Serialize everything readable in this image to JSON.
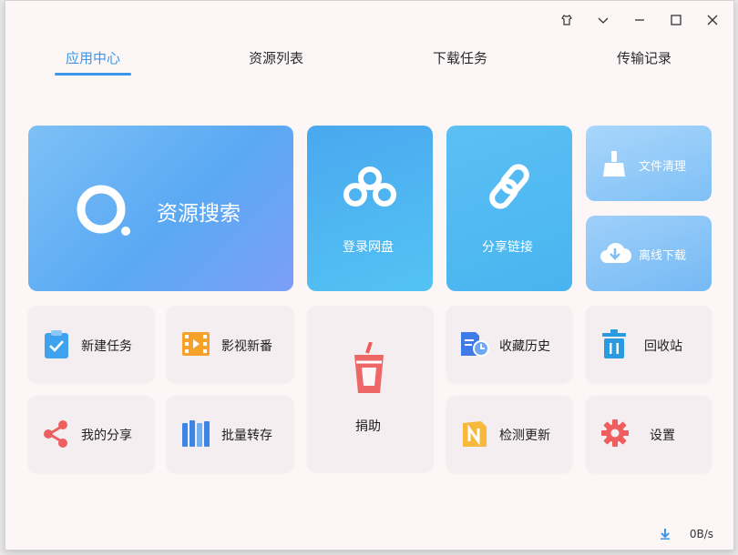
{
  "tabs": [
    {
      "label": "应用中心",
      "active": true
    },
    {
      "label": "资源列表",
      "active": false
    },
    {
      "label": "下载任务",
      "active": false
    },
    {
      "label": "传输记录",
      "active": false
    }
  ],
  "tiles": {
    "search": "资源搜索",
    "login_pan": "登录网盘",
    "share_link": "分享链接",
    "file_clean": "文件清理",
    "offline_download": "离线下载",
    "new_task": "新建任务",
    "video_new": "影视新番",
    "donate": "捐助",
    "favorites_history": "收藏历史",
    "recycle_bin": "回收站",
    "my_share": "我的分享",
    "batch_transfer": "批量转存",
    "check_update": "检测更新",
    "settings": "设置"
  },
  "status": {
    "speed": "0B/s"
  },
  "colors": {
    "accent": "#3d95e8",
    "tile_grey": "#f4eef0"
  }
}
